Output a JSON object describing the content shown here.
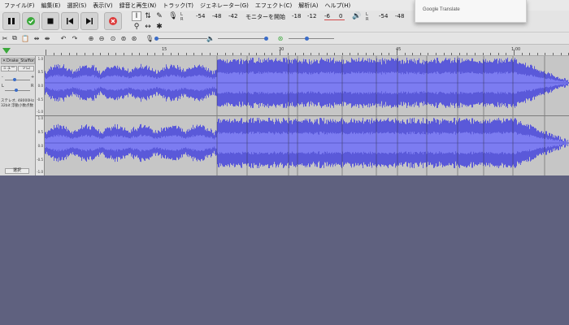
{
  "menu": [
    "ファイル(F)",
    "編集(E)",
    "選択(S)",
    "表示(V)",
    "録音と再生(N)",
    "トラック(T)",
    "ジェネレーター(G)",
    "エフェクト(C)",
    "解析(A)",
    "ヘルプ(H)"
  ],
  "transport": {
    "pause": "pause-icon",
    "play": "play-icon",
    "stop": "stop-icon",
    "skip_start": "skip-to-start-icon",
    "skip_end": "skip-to-end-icon",
    "record": "record-icon"
  },
  "record_meter": {
    "l": "L",
    "r": "R",
    "ticks": [
      "-54",
      "-48",
      "-42"
    ],
    "monitor_label": "モニターを開始",
    "ticks_right": [
      "-18",
      "-12",
      "-6",
      "0"
    ]
  },
  "playback_meter": {
    "l": "L",
    "r": "R",
    "ticks": [
      "-54",
      "-48"
    ]
  },
  "popup": {
    "text": "Google Translate"
  },
  "ruler": {
    "labels": [
      "15",
      "30",
      "45",
      "1:00"
    ]
  },
  "track": {
    "name": "Drake_Staffor",
    "mute": "ミュート",
    "solo": "ソロ",
    "gain_minus": "-",
    "gain_plus": "+",
    "pan_l": "L",
    "pan_r": "R",
    "info_line1": "ステレオ, 48000Hz",
    "info_line2": "32bit 浮動小数点数",
    "select_label": "選択"
  },
  "vertical_scale": [
    "1.0",
    "0.5",
    "0.0",
    "-0.5",
    "-1.0"
  ],
  "colors": {
    "waveform": "#5a59d9",
    "waveform_rms": "#7c7cf1",
    "background": "#5f617f",
    "track_bg": "#c6c6c6",
    "selected_bg": "#ffffff"
  }
}
